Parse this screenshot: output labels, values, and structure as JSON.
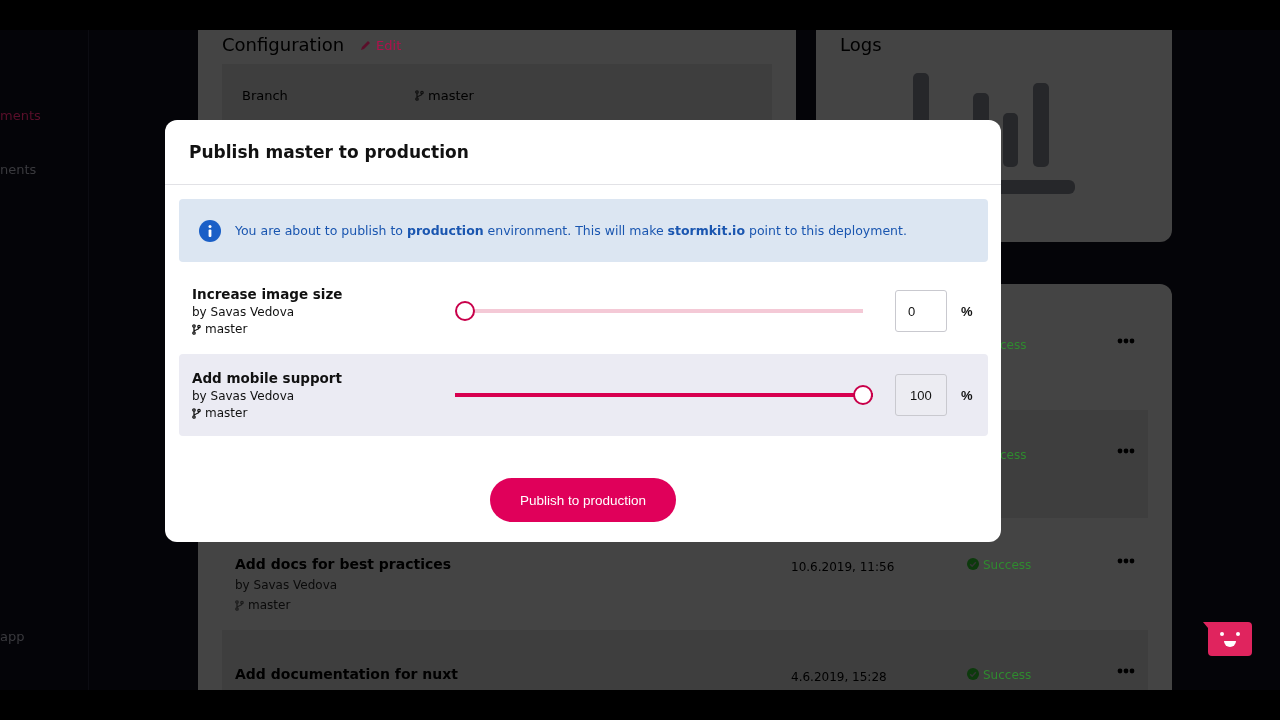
{
  "sidebar": {
    "items": [
      {
        "label": "ments",
        "selected": true
      },
      {
        "label": "nents",
        "selected": false
      },
      {
        "label": "app",
        "selected": false
      }
    ]
  },
  "configuration": {
    "title": "Configuration",
    "edit": "Edit",
    "fields": [
      {
        "label": "Branch",
        "value": "master"
      }
    ]
  },
  "logs": {
    "title": "Logs"
  },
  "deployments": [
    {
      "status": "cess",
      "covered": true
    },
    {
      "status": "cess",
      "covered": true
    },
    {
      "title": "Add docs for best practices",
      "author": "by Savas Vedova",
      "branch": "master",
      "date": "10.6.2019, 11:56",
      "status": "Success",
      "covered": false
    },
    {
      "title": "Add documentation for nuxt",
      "date": "4.6.2019, 15:28",
      "status": "Success",
      "covered": false
    }
  ],
  "dialog": {
    "title": "Publish master to production",
    "notice": "You are about to publish to **production** environment. This will make **stormkit.io** point to this deployment.",
    "items": [
      {
        "title": "Increase image size",
        "author": "by Savas Vedova",
        "branch": "master",
        "level": 0,
        "value": "0",
        "unit": "%",
        "highlighted": false
      },
      {
        "title": "Add mobile support",
        "author": "by Savas Vedova",
        "branch": "master",
        "level": 1,
        "value": "100",
        "unit": "%",
        "highlighted": true
      }
    ],
    "button": "Publish to production"
  }
}
